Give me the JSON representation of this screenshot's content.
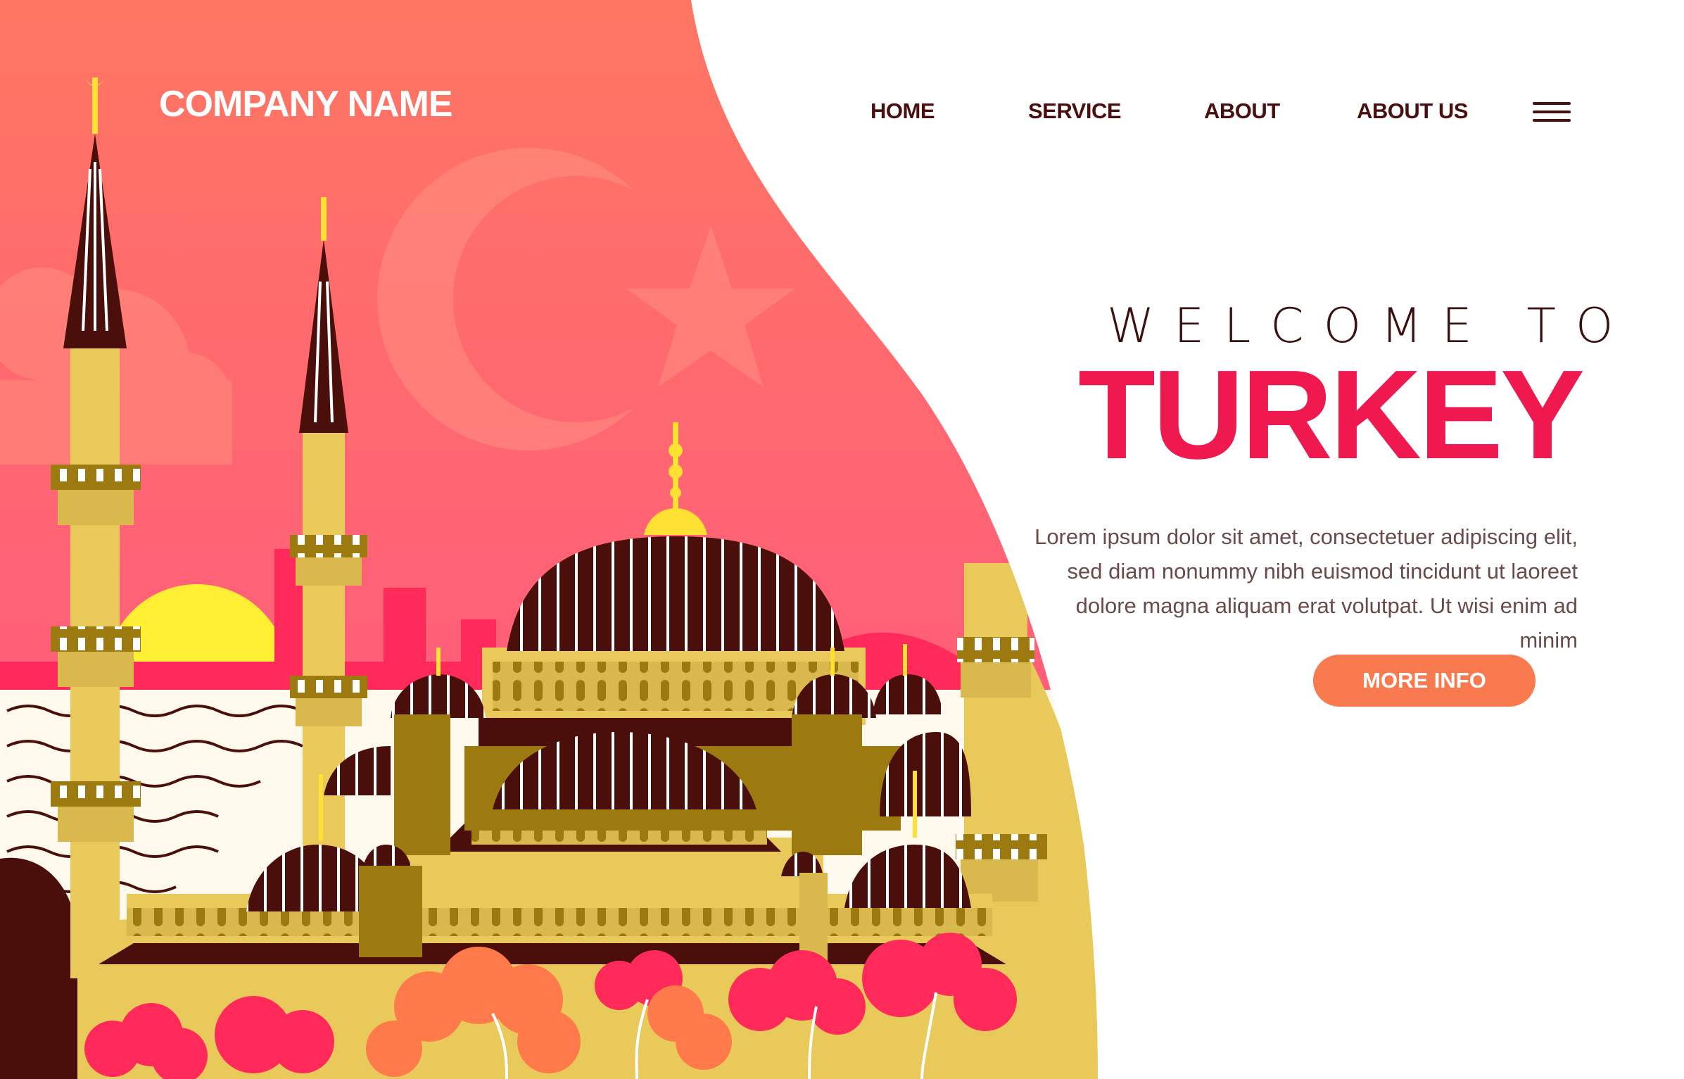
{
  "brand": {
    "name": "COMPANY NAME"
  },
  "nav": {
    "items": [
      {
        "label": "HOME"
      },
      {
        "label": "SERVICE"
      },
      {
        "label": "ABOUT"
      },
      {
        "label": "ABOUT US"
      }
    ],
    "menu_icon": "hamburger-menu-icon"
  },
  "hero": {
    "welcome": "WELCOME TO",
    "title": "TURKEY",
    "description": "Lorem ipsum dolor sit amet, consectetuer adipiscing elit, sed diam nonummy nibh euismod tincidunt ut laoreet dolore magna aliquam erat volutpat. Ut wisi enim ad minim",
    "cta_label": "MORE INFO"
  },
  "colors": {
    "accent": "#f0194f",
    "button": "#fa7a50",
    "nav_text": "#4a0f0f",
    "sky_top": "#ff7560",
    "sky_bottom": "#ff5a78",
    "mosque_gold": "#e8c95a",
    "dome_brown": "#4a0f0a"
  }
}
